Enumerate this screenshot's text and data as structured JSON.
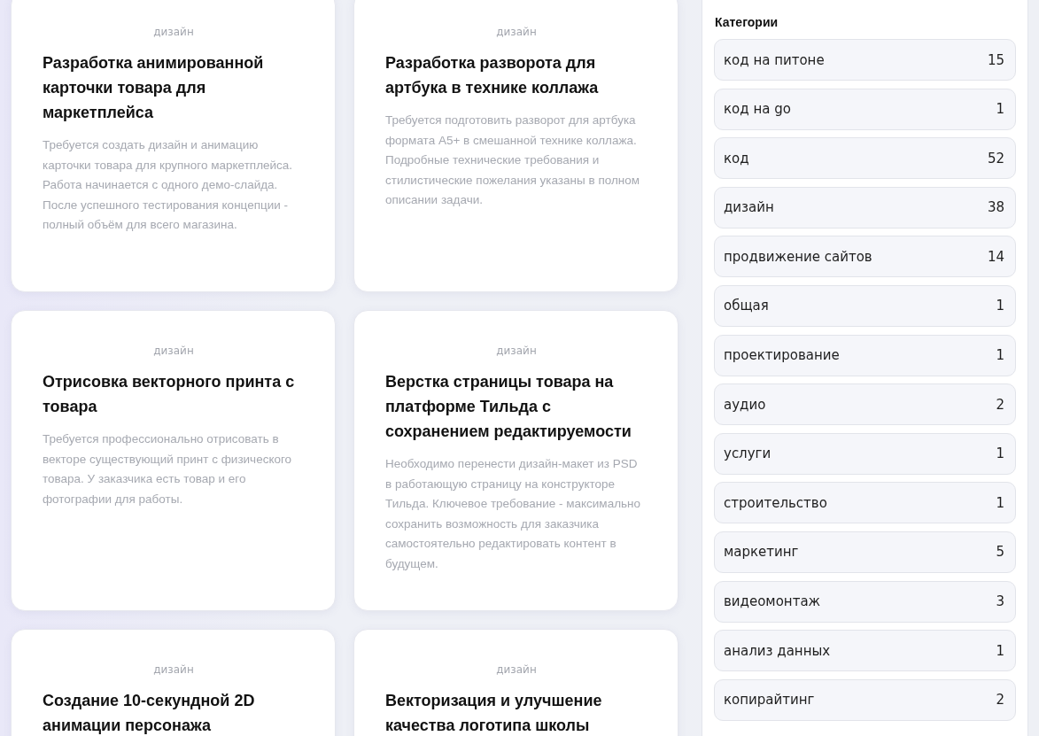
{
  "tasks": [
    {
      "category": "дизайн",
      "title": "Разработка анимированной карточки товара для маркетплейса",
      "description": "Требуется создать дизайн и анимацию карточки товара для крупного маркетплейса. Работа начинается с одного демо-слайда. После успешного тестирования концепции - полный объём для всего магазина."
    },
    {
      "category": "дизайн",
      "title": "Разработка разворота для артбука в технике коллажа",
      "description": "Требуется подготовить разворот для артбука формата А5+ в смешанной технике коллажа. Подробные технические требования и стилистические пожелания указаны в полном описании задачи."
    },
    {
      "category": "дизайн",
      "title": "Отрисовка векторного принта с товара",
      "description": "Требуется профессионально отрисовать в векторе существующий принт с физического товара. У заказчика есть товар и его фотографии для работы."
    },
    {
      "category": "дизайн",
      "title": "Верстка страницы товара на платформе Тильда с сохранением редактируемости",
      "description": "Необходимо перенести дизайн-макет из PSD в работающую страницу на конструкторе Тильда. Ключевое требование - максимально сохранить возможность для заказчика самостоятельно редактировать контент в будущем."
    },
    {
      "category": "дизайн",
      "title": "Создание 10-секундной 2D анимации персонажа"
    },
    {
      "category": "дизайн",
      "title": "Векторизация и улучшение качества логотипа школы"
    }
  ],
  "sidebar": {
    "title": "Категории",
    "items": [
      {
        "label": "код на питоне",
        "count": "15"
      },
      {
        "label": "код на go",
        "count": "1"
      },
      {
        "label": "код",
        "count": "52"
      },
      {
        "label": "дизайн",
        "count": "38"
      },
      {
        "label": "продвижение сайтов",
        "count": "14"
      },
      {
        "label": "общая",
        "count": "1"
      },
      {
        "label": "проектирование",
        "count": "1"
      },
      {
        "label": "аудио",
        "count": "2"
      },
      {
        "label": "услуги",
        "count": "1"
      },
      {
        "label": "строительство",
        "count": "1"
      },
      {
        "label": "маркетинг",
        "count": "5"
      },
      {
        "label": "видеомонтаж",
        "count": "3"
      },
      {
        "label": "анализ данных",
        "count": "1"
      },
      {
        "label": "копирайтинг",
        "count": "2"
      }
    ]
  }
}
